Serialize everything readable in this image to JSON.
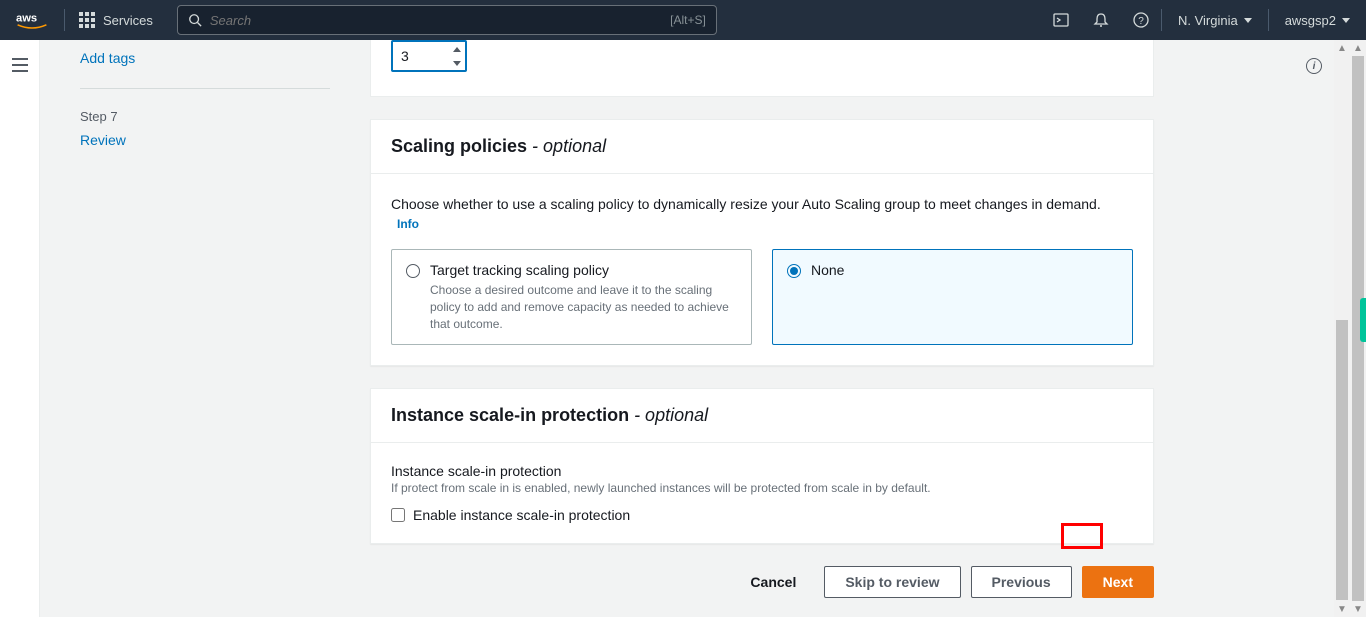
{
  "nav": {
    "services_label": "Services",
    "search_placeholder": "Search",
    "search_hint": "[Alt+S]",
    "region": "N. Virginia",
    "account": "awsgsp2"
  },
  "sidebar": {
    "add_tags": "Add tags",
    "step7_label": "Step 7",
    "review": "Review"
  },
  "group_size": {
    "value": "3"
  },
  "scaling": {
    "title": "Scaling policies",
    "optional": " - optional",
    "desc": "Choose whether to use a scaling policy to dynamically resize your Auto Scaling group to meet changes in demand.",
    "info": "Info",
    "opt_target_title": "Target tracking scaling policy",
    "opt_target_desc": "Choose a desired outcome and leave it to the scaling policy to add and remove capacity as needed to achieve that outcome.",
    "opt_none_title": "None"
  },
  "protection": {
    "title": "Instance scale-in protection",
    "optional": " - optional",
    "field_label": "Instance scale-in protection",
    "field_hint": "If protect from scale in is enabled, newly launched instances will be protected from scale in by default.",
    "checkbox_label": "Enable instance scale-in protection"
  },
  "footer": {
    "cancel": "Cancel",
    "skip": "Skip to review",
    "previous": "Previous",
    "next": "Next"
  }
}
